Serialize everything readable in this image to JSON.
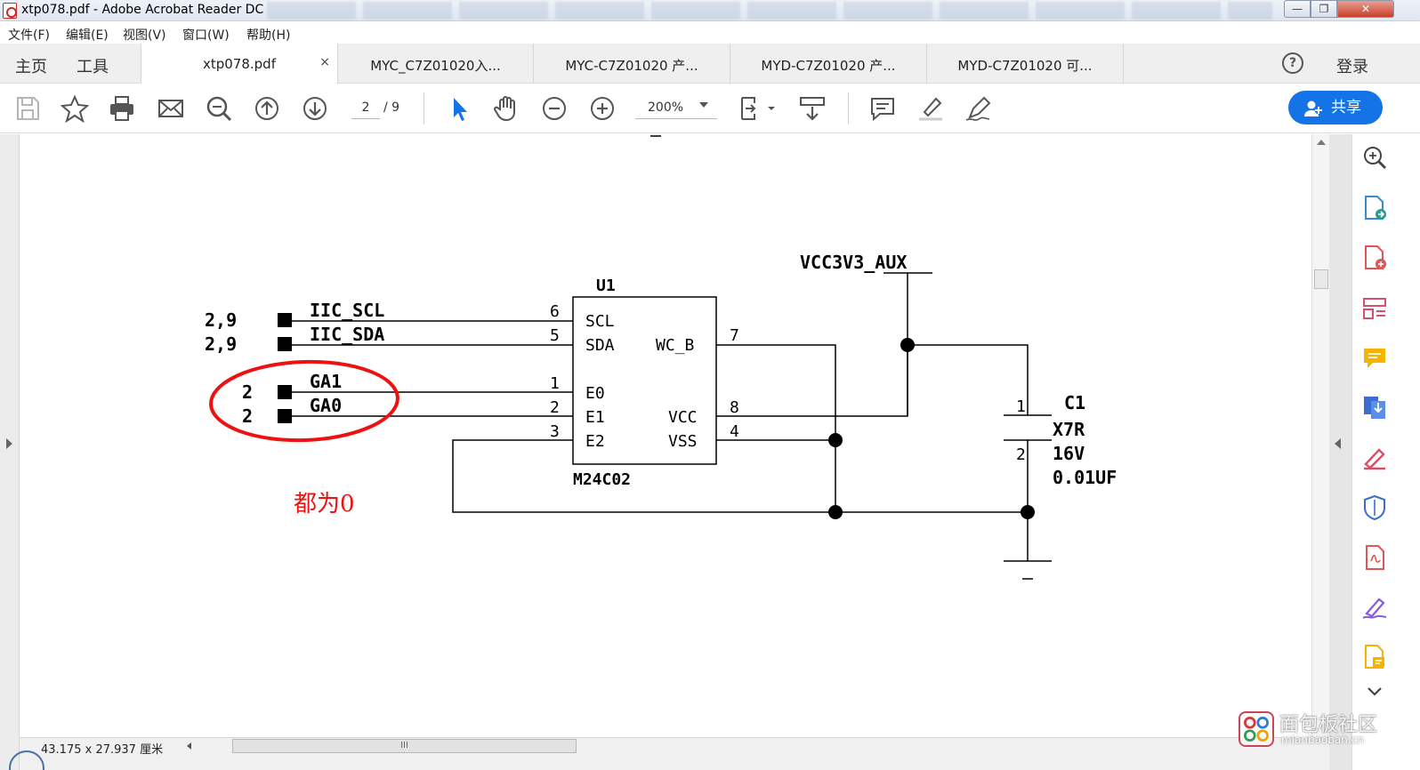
{
  "window": {
    "title": "xtp078.pdf - Adobe Acrobat Reader DC",
    "controls": {
      "minimize": "—",
      "maximize": "❐",
      "close": "✕"
    }
  },
  "menu": [
    "文件(F)",
    "编辑(E)",
    "视图(V)",
    "窗口(W)",
    "帮助(H)"
  ],
  "tabs": {
    "home": "主页",
    "tools": "工具",
    "documents": [
      {
        "label": "xtp078.pdf",
        "active": true,
        "close": "×"
      },
      {
        "label": "MYC_C7Z01020入...",
        "active": false
      },
      {
        "label": "MYC-C7Z01020 产...",
        "active": false
      },
      {
        "label": "MYD-C7Z01020 产...",
        "active": false
      },
      {
        "label": "MYD-C7Z01020 可...",
        "active": false
      }
    ],
    "help": "?",
    "login": "登录"
  },
  "toolbar": {
    "icons": [
      "save-icon",
      "bookmark-star-icon",
      "print-icon",
      "email-icon",
      "search-icon",
      "page-up-icon",
      "page-down-icon",
      "select-cursor-icon",
      "hand-tool-icon",
      "zoom-out-icon",
      "zoom-in-icon",
      "fit-page-icon",
      "scroll-mode-icon",
      "comment-icon",
      "highlight-icon",
      "sign-icon"
    ],
    "current_page": "2",
    "total_pages": "/ 9",
    "zoom": "200%",
    "share": "共享",
    "accent": "#1473e6"
  },
  "schematic": {
    "power_net": "VCC3V3_AUX",
    "ic": {
      "ref": "U1",
      "part": "M24C02",
      "left_pins": [
        {
          "num": "6",
          "name": "SCL"
        },
        {
          "num": "5",
          "name": "SDA"
        },
        {
          "num": "1",
          "name": "E0"
        },
        {
          "num": "2",
          "name": "E1"
        },
        {
          "num": "3",
          "name": "E2"
        }
      ],
      "right_pins": [
        {
          "num": "7",
          "name": "WC_B"
        },
        {
          "num": "8",
          "name": "VCC"
        },
        {
          "num": "4",
          "name": "VSS"
        }
      ]
    },
    "ports": [
      {
        "ref": "2,9",
        "net": "IIC_SCL"
      },
      {
        "ref": "2,9",
        "net": "IIC_SDA"
      },
      {
        "ref": "2",
        "net": "GA1"
      },
      {
        "ref": "2",
        "net": "GA0"
      }
    ],
    "capacitor": {
      "ref": "C1",
      "pin1": "1",
      "pin2": "2",
      "type": "X7R",
      "voltage": "16V",
      "value": "0.01UF"
    },
    "annotation": "都为0",
    "annotation_color": "#e11"
  },
  "status": {
    "page_size": "43.175 x 27.937 厘米",
    "hscroll_grip": "III"
  },
  "right_rail_icons": [
    "zoom-search-icon",
    "export-pdf-icon",
    "create-pdf-icon",
    "organize-pages-icon",
    "comment-tool-icon",
    "send-file-icon",
    "fill-sign-icon",
    "protect-icon",
    "pdf-file-icon",
    "signature-icon",
    "share-file-icon",
    "expand-more-icon"
  ],
  "watermark": {
    "cn": "面包板社区",
    "en": "mianbaoban.cn"
  }
}
